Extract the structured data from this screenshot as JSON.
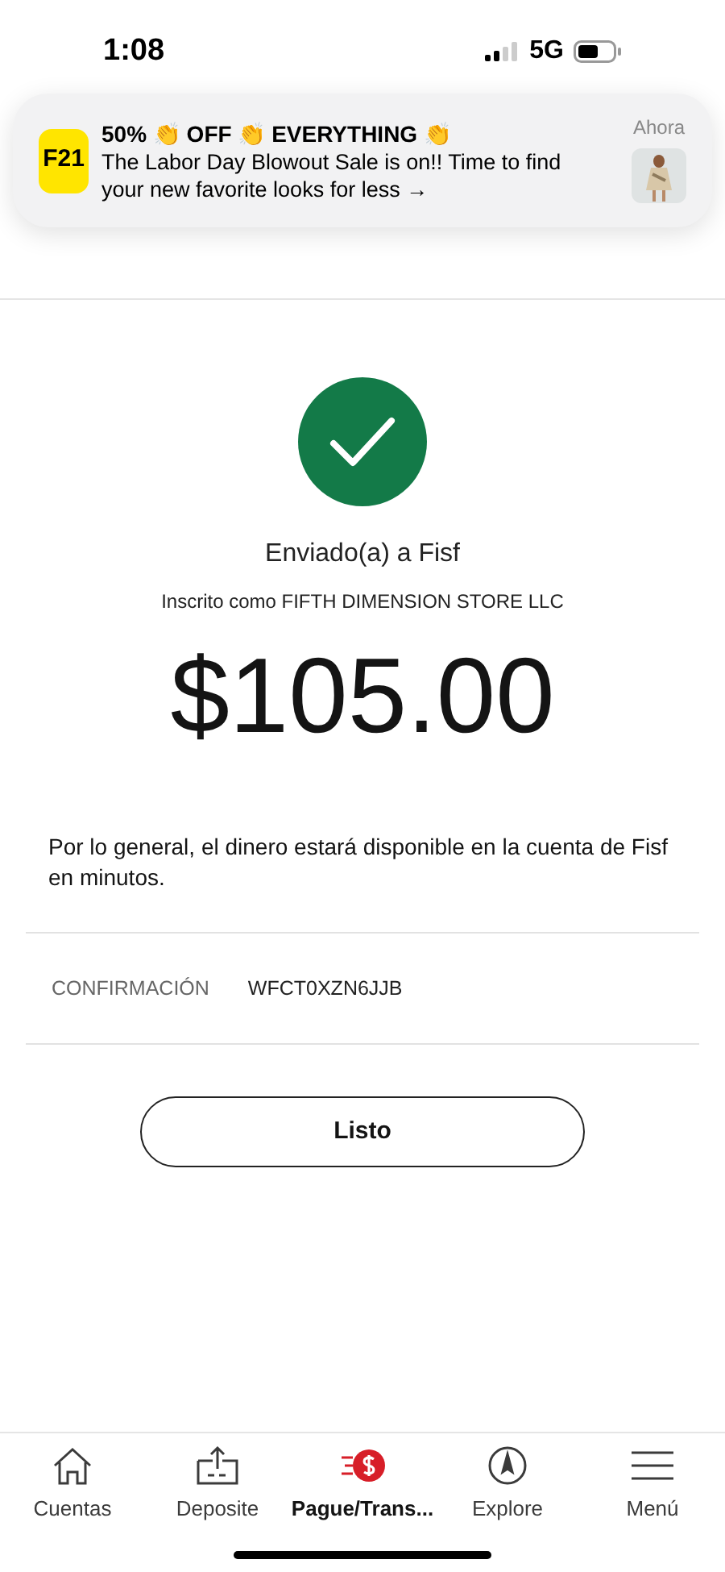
{
  "status_bar": {
    "time": "1:08",
    "network": "5G"
  },
  "notification": {
    "app_logo": "F21",
    "title": "50% 👏 OFF 👏 EVERYTHING 👏",
    "body": "The Labor Day Blowout Sale is on!! Time to find your new favorite looks for less →",
    "time": "Ahora"
  },
  "result": {
    "recipient": "Enviado(a) a Fisf",
    "enrolled_as": "Inscrito como FIFTH DIMENSION STORE LLC",
    "amount": "$105.00",
    "note": "Por lo general, el dinero estará disponible en la cuenta de Fisf en minutos."
  },
  "confirmation": {
    "label": "CONFIRMACIÓN",
    "value": "WFCT0XZN6JJB"
  },
  "done_button": "Listo",
  "tab_bar": [
    {
      "kind": "home",
      "label": "Cuentas",
      "selected": false
    },
    {
      "kind": "deposit",
      "label": "Deposite",
      "selected": false
    },
    {
      "kind": "pay",
      "label": "Pague/Trans...",
      "selected": true
    },
    {
      "kind": "explore",
      "label": "Explore",
      "selected": false
    },
    {
      "kind": "menu",
      "label": "Menú",
      "selected": false
    }
  ]
}
